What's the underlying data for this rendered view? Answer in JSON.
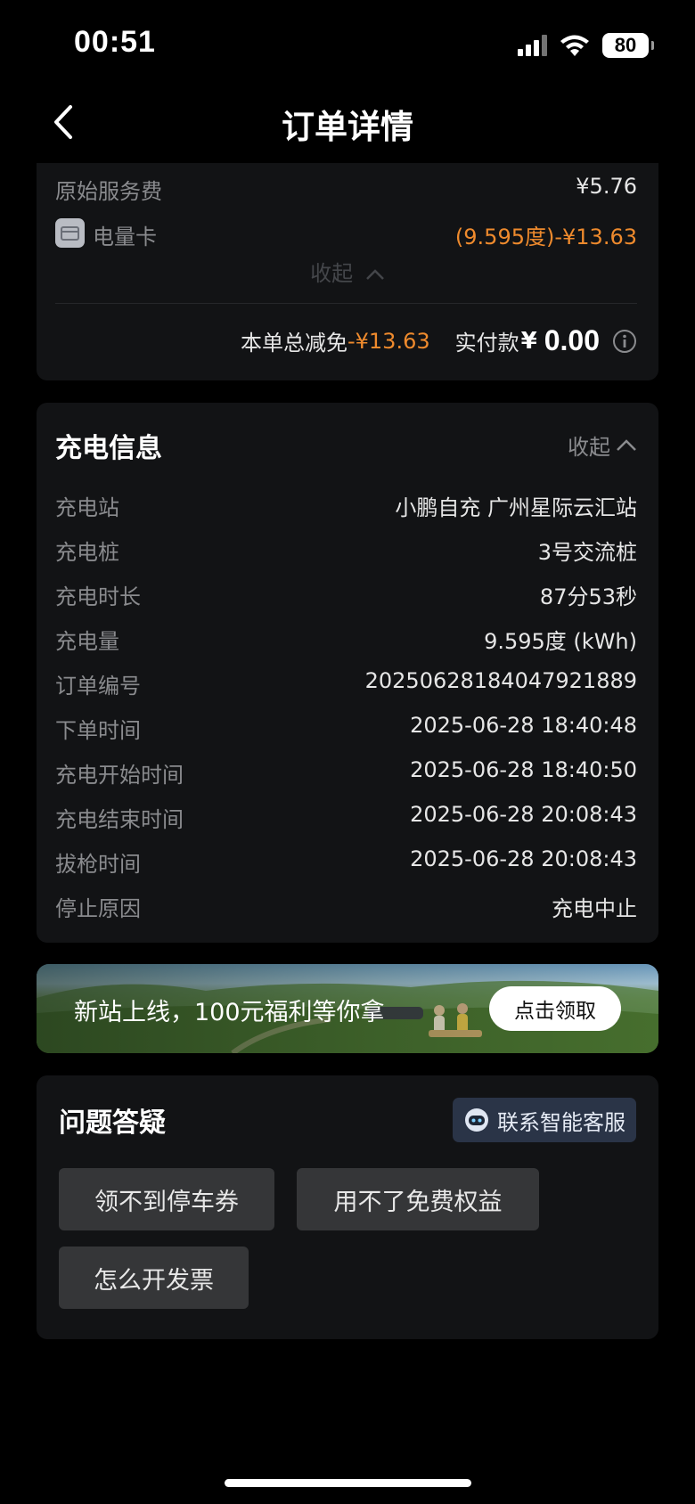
{
  "status_bar": {
    "time": "00:51",
    "battery": "80"
  },
  "nav": {
    "title": "订单详情"
  },
  "fee_card": {
    "original_fee_label": "原始服务费",
    "original_fee_value": "¥5.76",
    "energy_card_label": "电量卡",
    "energy_card_value": "(9.595度)-¥13.63",
    "collapse_label": "收起",
    "total_discount_label": "本单总减免",
    "total_discount_value": "-¥13.63",
    "paid_label": "实付款",
    "paid_currency": "¥",
    "paid_amount": "0.00"
  },
  "charging_info": {
    "title": "充电信息",
    "collapse_label": "收起",
    "rows": [
      {
        "label": "充电站",
        "value": "小鹏自充 广州星际云汇站"
      },
      {
        "label": "充电桩",
        "value": "3号交流桩"
      },
      {
        "label": "充电时长",
        "value": "87分53秒"
      },
      {
        "label": "充电量",
        "value": "9.595度 (kWh)"
      },
      {
        "label": "订单编号",
        "value": "20250628184047921889"
      },
      {
        "label": "下单时间",
        "value": "2025-06-28 18:40:48"
      },
      {
        "label": "充电开始时间",
        "value": "2025-06-28 18:40:50"
      },
      {
        "label": "充电结束时间",
        "value": "2025-06-28 20:08:43"
      },
      {
        "label": "拔枪时间",
        "value": "2025-06-28 20:08:43"
      },
      {
        "label": "停止原因",
        "value": "充电中止"
      }
    ]
  },
  "banner": {
    "text": "新站上线，100元福利等你拿",
    "button_label": "点击领取"
  },
  "faq": {
    "title": "问题答疑",
    "contact_label": "联系智能客服",
    "chips": [
      "领不到停车券",
      "用不了免费权益",
      "怎么开发票"
    ]
  },
  "colors": {
    "accent_orange": "#ee8a2d",
    "card_bg": "#121315",
    "page_bg": "#000000"
  }
}
